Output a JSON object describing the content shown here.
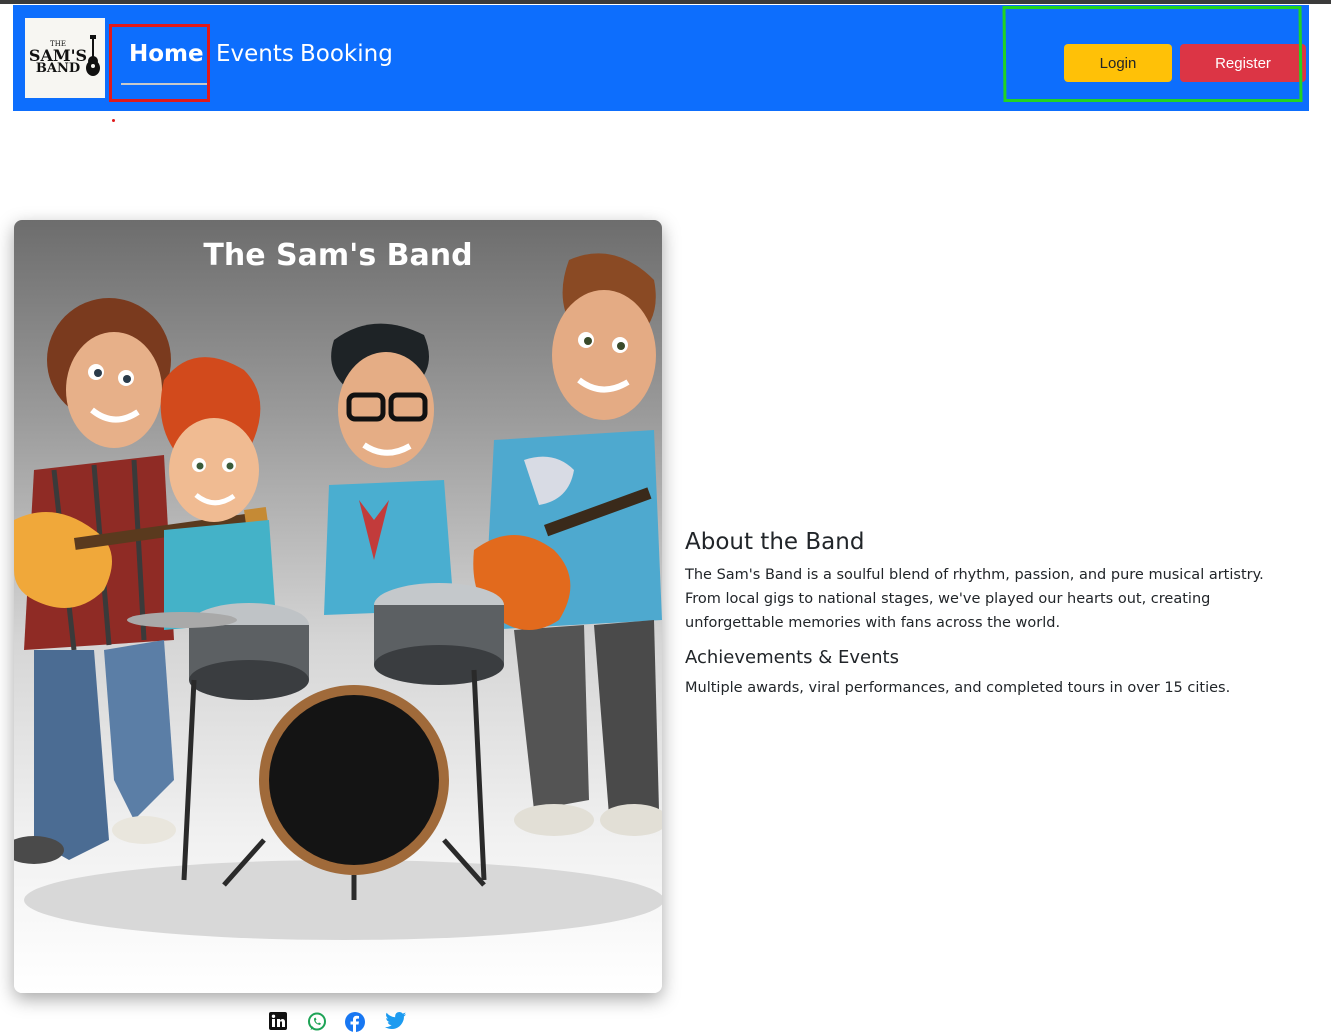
{
  "header": {
    "logo": {
      "line1": "THE",
      "line2": "SAM'S",
      "line3": "BAND"
    },
    "nav": [
      {
        "label": "Home",
        "active": true
      },
      {
        "label": "Events"
      },
      {
        "label": "Booking"
      }
    ],
    "login_label": "Login",
    "register_label": "Register"
  },
  "hero": {
    "title": "The Sam's Band"
  },
  "about": {
    "heading": "About the Band",
    "text": "The Sam's Band is a soulful blend of rhythm, passion, and pure musical artistry. From local gigs to national stages, we've played our hearts out, creating unforgettable memories with fans across the world.",
    "achievements_heading": "Achievements & Events",
    "achievements_text": "Multiple awards, viral performances, and completed tours in over 15 cities."
  },
  "social": {
    "icons": [
      "linkedin-icon",
      "whatsapp-icon",
      "facebook-icon",
      "twitter-icon"
    ]
  },
  "colors": {
    "navbar": "#0d6efd",
    "login": "#ffc107",
    "register": "#dc3545",
    "annotation_red": "#e0191b",
    "annotation_green": "#22d322"
  }
}
